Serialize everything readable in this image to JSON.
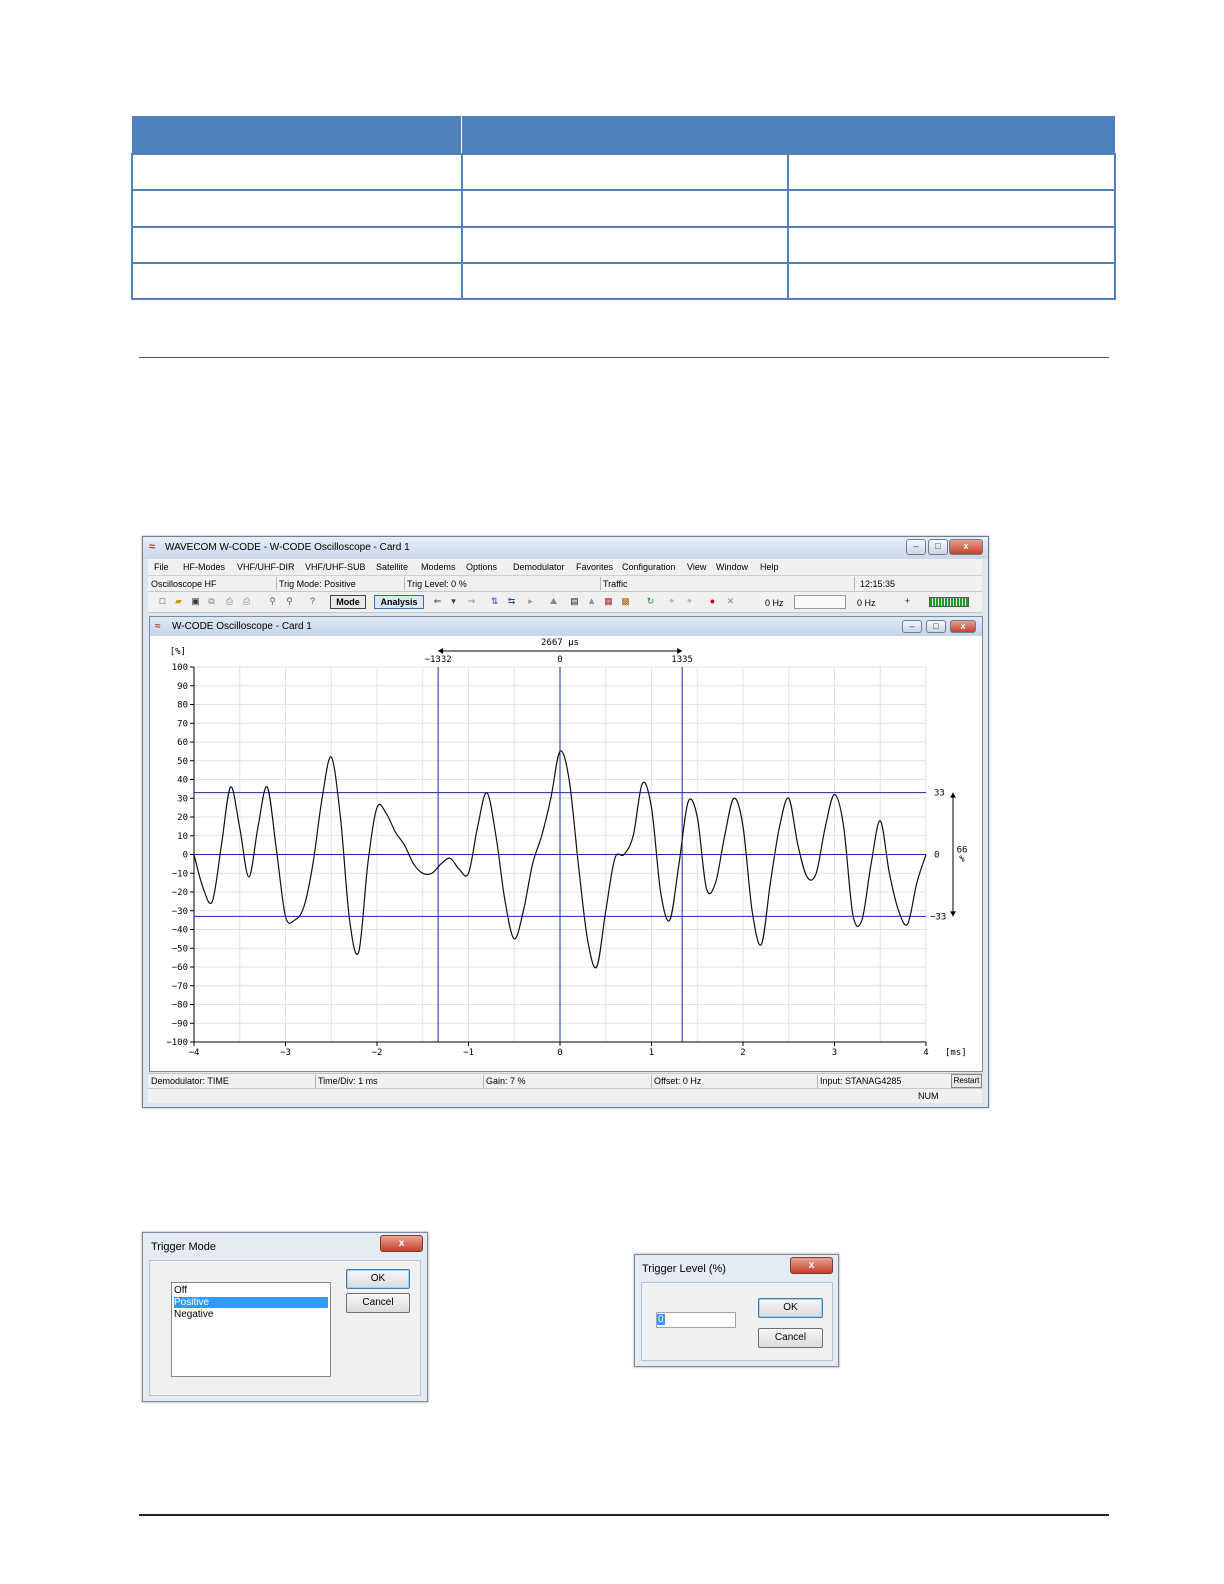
{
  "main_window": {
    "title": "WAVECOM W-CODE - W-CODE Oscilloscope  - Card 1",
    "menu": [
      "File",
      "HF-Modes",
      "VHF/UHF-DIR",
      "VHF/UHF-SUB",
      "Satellite",
      "Modems",
      "Options",
      "Demodulator",
      "Favorites",
      "Configuration",
      "View",
      "Window",
      "Help"
    ],
    "status": {
      "mode": "Oscilloscope HF",
      "trig_mode": "Trig Mode: Positive",
      "trig_level": "Trig Level: 0 %",
      "traffic": "Traffic",
      "time": "12:15:35"
    },
    "toolbar": {
      "mode_button": "Mode",
      "analysis_button": "Analysis",
      "freq_left": "0 Hz",
      "freq_right": "0 Hz",
      "icons": [
        "new-icon",
        "open-icon",
        "save-icon",
        "copy-icon",
        "print-icon",
        "print-preview-icon",
        "find-icon",
        "find-next-icon",
        "help-icon",
        "arrow-left-icon",
        "arrow-down-icon",
        "arrow-right-icon",
        "sync-icon",
        "sync-alt-icon",
        "play-icon",
        "mountain-icon",
        "screen-icon",
        "tuning-icon",
        "grid-icon",
        "pattern-icon",
        "refresh-icon",
        "record-icon",
        "rec-off-icon",
        "rec-icon",
        "stop-icon",
        "plus-icon"
      ]
    },
    "bottom_status": {
      "demodulator": "Demodulator: TIME",
      "time_div": "Time/Div: 1 ms",
      "gain": "Gain: 7 %",
      "offset": "Offset: 0 Hz",
      "input": "Input: STANAG4285",
      "restart": "Restart",
      "num": "NUM"
    }
  },
  "child_window": {
    "title": "W-CODE Oscilloscope  - Card 1"
  },
  "chart_data": {
    "type": "line",
    "ylabel": "[%]",
    "xlabel": "[ms]",
    "xlim": [
      -4,
      4
    ],
    "ylim": [
      -100,
      100
    ],
    "y_ticks": [
      100,
      90,
      80,
      70,
      60,
      50,
      40,
      30,
      20,
      10,
      0,
      -10,
      -20,
      -30,
      -40,
      -50,
      -60,
      -70,
      -80,
      -90,
      -100
    ],
    "x_ticks": [
      -4,
      -3,
      -2,
      -1,
      0,
      1,
      2,
      3,
      4
    ],
    "grid": true,
    "cursor_markers": {
      "left": "-1332",
      "center": "0",
      "right": "1335",
      "span": "2667 μs"
    },
    "vertical_cursors_ms": [
      -1.332,
      0,
      1.335
    ],
    "horizontal_levels": [
      33,
      0,
      -33
    ],
    "level_labels": {
      "upper": "33",
      "center": "0",
      "lower": "-33",
      "span_value": "66",
      "span_unit": "%"
    },
    "series": [
      {
        "x": [
          -4.0,
          -3.9,
          -3.8,
          -3.7,
          -3.6,
          -3.5,
          -3.4,
          -3.3,
          -3.2,
          -3.1,
          -3.0,
          -2.9,
          -2.8,
          -2.7,
          -2.6,
          -2.5,
          -2.4,
          -2.3,
          -2.2,
          -2.1,
          -2.0,
          -1.9,
          -1.8,
          -1.7,
          -1.6,
          -1.5,
          -1.4,
          -1.3,
          -1.2,
          -1.1,
          -1.0,
          -0.9,
          -0.8,
          -0.7,
          -0.6,
          -0.5,
          -0.4,
          -0.3,
          -0.2,
          -0.1,
          0.0,
          0.1,
          0.2,
          0.3,
          0.4,
          0.5,
          0.6,
          0.7,
          0.8,
          0.9,
          1.0,
          1.1,
          1.2,
          1.3,
          1.4,
          1.5,
          1.6,
          1.7,
          1.8,
          1.9,
          2.0,
          2.1,
          2.2,
          2.3,
          2.4,
          2.5,
          2.6,
          2.7,
          2.8,
          2.9,
          3.0,
          3.1,
          3.2,
          3.3,
          3.4,
          3.5,
          3.6,
          3.7,
          3.8,
          3.9,
          4.0
        ],
        "y": [
          0,
          -18,
          -25,
          5,
          36,
          14,
          -12,
          15,
          36,
          3,
          -33,
          -35,
          -28,
          -5,
          30,
          52,
          20,
          -35,
          -52,
          -5,
          25,
          22,
          12,
          5,
          -5,
          -10,
          -10,
          -5,
          -2,
          -8,
          -10,
          15,
          33,
          10,
          -25,
          -45,
          -30,
          -5,
          10,
          30,
          55,
          40,
          -5,
          -45,
          -60,
          -30,
          -2,
          0,
          10,
          38,
          25,
          -20,
          -35,
          -5,
          28,
          20,
          -18,
          -15,
          10,
          30,
          15,
          -30,
          -48,
          -15,
          15,
          30,
          5,
          -12,
          -10,
          15,
          32,
          15,
          -32,
          -35,
          -5,
          18,
          -10,
          -30,
          -37,
          -15,
          0
        ]
      }
    ]
  },
  "trigger_mode_dialog": {
    "title": "Trigger Mode",
    "options": [
      "Off",
      "Positive",
      "Negative"
    ],
    "selected": "Positive",
    "ok": "OK",
    "cancel": "Cancel",
    "close": "x"
  },
  "trigger_level_dialog": {
    "title": "Trigger Level (%)",
    "value": "0",
    "ok": "OK",
    "cancel": "Cancel",
    "close": "x"
  }
}
